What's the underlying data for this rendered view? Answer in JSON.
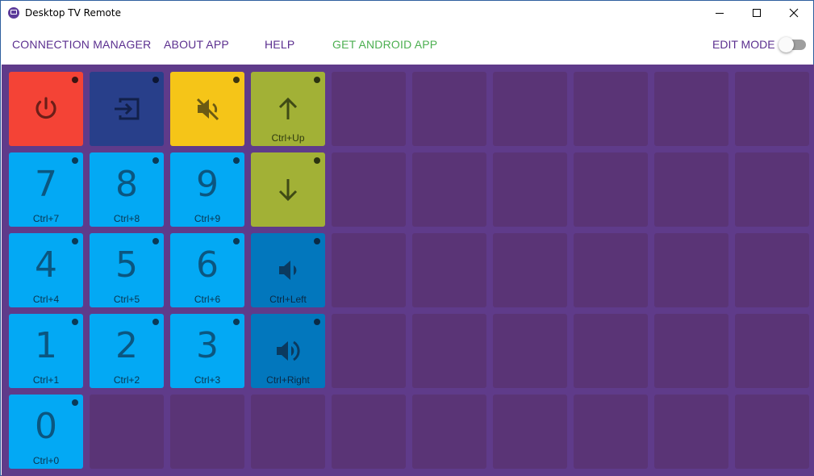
{
  "window": {
    "title": "Desktop TV Remote"
  },
  "menu": {
    "connection_manager": "CONNECTION MANAGER",
    "about_app": "ABOUT APP",
    "help": "HELP",
    "get_android_app": "GET ANDROID APP",
    "edit_mode": "EDIT MODE",
    "edit_mode_on": false
  },
  "colors": {
    "red": "#f44336",
    "indigo": "#283f8a",
    "yellow": "#f5c518",
    "olive": "#a2b136",
    "cyan": "#03a9f4",
    "blue": "#0277bd",
    "empty": "#5a3476",
    "background": "#5f3b8a",
    "accent": "#5b2f8f",
    "android": "#4caf50"
  },
  "buttons": [
    {
      "icon": "power-icon",
      "label": "",
      "color": "red"
    },
    {
      "icon": "input-icon",
      "label": "",
      "color": "indigo"
    },
    {
      "icon": "mute-icon",
      "label": "",
      "color": "yellow"
    },
    {
      "icon": "arrow-up-icon",
      "label": "Ctrl+Up",
      "color": "olive"
    },
    {
      "number": "7",
      "label": "Ctrl+7",
      "color": "cyan"
    },
    {
      "number": "8",
      "label": "Ctrl+8",
      "color": "cyan"
    },
    {
      "number": "9",
      "label": "Ctrl+9",
      "color": "cyan"
    },
    {
      "icon": "arrow-down-icon",
      "label": "",
      "color": "olive"
    },
    {
      "number": "4",
      "label": "Ctrl+4",
      "color": "cyan"
    },
    {
      "number": "5",
      "label": "Ctrl+5",
      "color": "cyan"
    },
    {
      "number": "6",
      "label": "Ctrl+6",
      "color": "cyan"
    },
    {
      "icon": "volume-down-icon",
      "label": "Ctrl+Left",
      "color": "blue"
    },
    {
      "number": "1",
      "label": "Ctrl+1",
      "color": "cyan"
    },
    {
      "number": "2",
      "label": "Ctrl+2",
      "color": "cyan"
    },
    {
      "number": "3",
      "label": "Ctrl+3",
      "color": "cyan"
    },
    {
      "icon": "volume-up-icon",
      "label": "Ctrl+Right",
      "color": "blue"
    },
    {
      "number": "0",
      "label": "Ctrl+0",
      "color": "cyan"
    }
  ]
}
